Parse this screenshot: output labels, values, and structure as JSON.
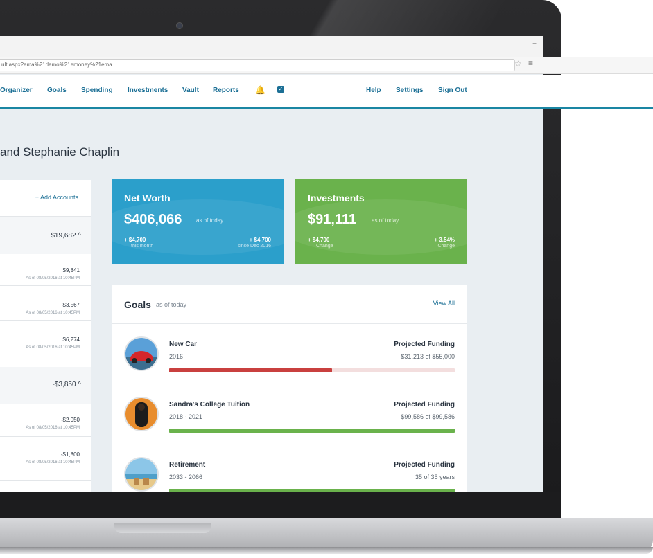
{
  "browser": {
    "url": "ult.aspx?ema%21demo%21emoney%21ema"
  },
  "nav": {
    "items": [
      "Organizer",
      "Goals",
      "Spending",
      "Investments",
      "Vault",
      "Reports"
    ],
    "right_items": [
      "Help",
      "Settings",
      "Sign Out"
    ]
  },
  "greeting": "and Stephanie Chaplin",
  "accounts": {
    "add_label": "+ Add Accounts",
    "groups": [
      {
        "total": "$19,682  ^",
        "accounts": [
          {
            "amount": "$9,841",
            "date": "As of 08/05/2016 at 10:45PM"
          },
          {
            "amount": "$3,567",
            "date": "As of 08/05/2016 at 10:45PM"
          },
          {
            "amount": "$6,274",
            "date": "As of 08/05/2016 at 10:45PM"
          }
        ]
      },
      {
        "total": "-$3,850  ^",
        "accounts": [
          {
            "amount": "-$2,050",
            "date": "As of 08/05/2016 at 10:45PM"
          },
          {
            "amount": "-$1,800",
            "date": "As of 08/05/2016 at 10:45PM"
          }
        ]
      }
    ]
  },
  "net_worth": {
    "title": "Net Worth",
    "value": "$406,066",
    "as_of": "as of today",
    "stat_left": "+ $4,700",
    "stat_left_sub": "this month",
    "stat_right": "+ $4,700",
    "stat_right_sub": "since Dec 2016"
  },
  "investments": {
    "title": "Investments",
    "value": "$91,111",
    "as_of": "as of today",
    "stat_left": "+ $4,700",
    "stat_left_sub": "Change",
    "stat_right": "+ 3.54%",
    "stat_right_sub": "Change"
  },
  "goals": {
    "title": "Goals",
    "as_of": "as of today",
    "view_all": "View All",
    "items": [
      {
        "name": "New Car",
        "years": "2016",
        "label": "Projected Funding",
        "funding": "$31,213 of $55,000",
        "progress": 0.57,
        "color": "#c9403f",
        "avatar": "car-photo"
      },
      {
        "name": "Sandra's College Tuition",
        "years": "2018 - 2021",
        "label": "Projected Funding",
        "funding": "$99,586 of $99,586",
        "progress": 1.0,
        "color": "#6ab24c",
        "avatar": "graduate-photo"
      },
      {
        "name": "Retirement",
        "years": "2033 - 2066",
        "label": "Projected Funding",
        "funding": "35 of 35 years",
        "progress": 1.0,
        "color": "#6ab24c",
        "avatar": "beach-photo"
      }
    ]
  },
  "colors": {
    "brand": "#1b6f95",
    "net_worth_tile": "#2b9fcb",
    "investments_tile": "#6ab24c",
    "goal_red": "#c9403f",
    "goal_green": "#6ab24c"
  }
}
